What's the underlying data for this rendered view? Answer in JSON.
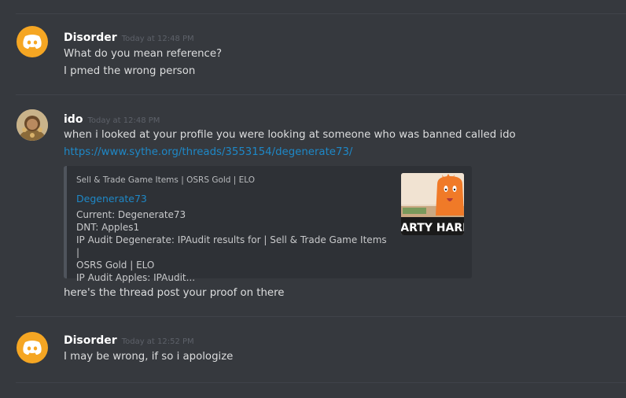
{
  "messages": [
    {
      "author": "Disorder",
      "timestamp": "Today at 12:48 PM",
      "lines": [
        "What do you mean reference?",
        "I pmed the wrong person"
      ]
    },
    {
      "author": "ido",
      "timestamp": "Today at 12:48 PM",
      "lines": [
        "when i looked at your profile you were looking at someone who was banned called ido"
      ],
      "link": "https://www.sythe.org/threads/3553154/degenerate73/",
      "embed": {
        "provider": "Sell & Trade Game Items | OSRS Gold | ELO",
        "title": "Degenerate73",
        "description": [
          "Current: Degenerate73",
          "DNT: Apples1",
          "IP Audit Degenerate: IPAudit results for | Sell & Trade Game Items |",
          "OSRS Gold | ELO",
          "IP Audit Apples: IPAudit..."
        ],
        "thumbnail_text": "PARTY HARD"
      },
      "followup": "here's the thread post your proof on there"
    },
    {
      "author": "Disorder",
      "timestamp": "Today at 12:52 PM",
      "lines": [
        "I may be wrong, if so i apologize"
      ]
    }
  ],
  "colors": {
    "background": "#36393e",
    "username": "#ffffff",
    "timestamp": "#5d6169",
    "link": "#1e88c7",
    "discord_avatar": "#f5a623"
  }
}
